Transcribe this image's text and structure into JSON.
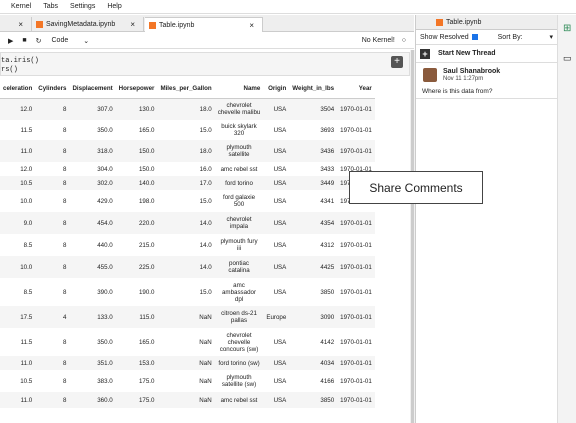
{
  "menu": [
    "Kernel",
    "Tabs",
    "Settings",
    "Help"
  ],
  "tabs": [
    {
      "label": "SavingMetadata.ipynb"
    },
    {
      "label": "Table.ipynb"
    }
  ],
  "toolbar": {
    "cell_type": "Code",
    "kernel_status": "No Kernel!"
  },
  "code": {
    "line1": "ta.iris()",
    "line2": "rs()"
  },
  "table": {
    "headers": [
      "celeration",
      "Cylinders",
      "Displacement",
      "Horsepower",
      "Miles_per_Gallon",
      "Name",
      "Origin",
      "Weight_in_lbs",
      "Year"
    ],
    "rows": [
      [
        "12.0",
        "8",
        "307.0",
        "130.0",
        "18.0",
        "chevrolet\nchevelle malibu",
        "USA",
        "3504",
        "1970-01-01"
      ],
      [
        "11.5",
        "8",
        "350.0",
        "165.0",
        "15.0",
        "buick skylark\n320",
        "USA",
        "3693",
        "1970-01-01"
      ],
      [
        "11.0",
        "8",
        "318.0",
        "150.0",
        "18.0",
        "plymouth\nsatellite",
        "USA",
        "3436",
        "1970-01-01"
      ],
      [
        "12.0",
        "8",
        "304.0",
        "150.0",
        "16.0",
        "amc rebel sst",
        "USA",
        "3433",
        "1970-01-01"
      ],
      [
        "10.5",
        "8",
        "302.0",
        "140.0",
        "17.0",
        "ford torino",
        "USA",
        "3449",
        "1970-01-01"
      ],
      [
        "10.0",
        "8",
        "429.0",
        "198.0",
        "15.0",
        "ford galaxie\n500",
        "USA",
        "4341",
        "1970-01-01"
      ],
      [
        "9.0",
        "8",
        "454.0",
        "220.0",
        "14.0",
        "chevrolet\nimpala",
        "USA",
        "4354",
        "1970-01-01"
      ],
      [
        "8.5",
        "8",
        "440.0",
        "215.0",
        "14.0",
        "plymouth fury\niii",
        "USA",
        "4312",
        "1970-01-01"
      ],
      [
        "10.0",
        "8",
        "455.0",
        "225.0",
        "14.0",
        "pontiac\ncatalina",
        "USA",
        "4425",
        "1970-01-01"
      ],
      [
        "8.5",
        "8",
        "390.0",
        "190.0",
        "15.0",
        "amc\nambassador\ndpl",
        "USA",
        "3850",
        "1970-01-01"
      ],
      [
        "17.5",
        "4",
        "133.0",
        "115.0",
        "NaN",
        "citroen ds-21\npallas",
        "Europe",
        "3090",
        "1970-01-01"
      ],
      [
        "11.5",
        "8",
        "350.0",
        "165.0",
        "NaN",
        "chevrolet\nchevelle\nconcours (sw)",
        "USA",
        "4142",
        "1970-01-01"
      ],
      [
        "11.0",
        "8",
        "351.0",
        "153.0",
        "NaN",
        "ford torino (sw)",
        "USA",
        "4034",
        "1970-01-01"
      ],
      [
        "10.5",
        "8",
        "383.0",
        "175.0",
        "NaN",
        "plymouth\nsatellite (sw)",
        "USA",
        "4166",
        "1970-01-01"
      ],
      [
        "11.0",
        "8",
        "360.0",
        "175.0",
        "NaN",
        "amc rebel sst",
        "USA",
        "3850",
        "1970-01-01"
      ]
    ]
  },
  "side": {
    "title": "Table.ipynb",
    "show_resolved": "Show Resolved",
    "sort_by": "Sort By:",
    "new_thread": "Start New Thread",
    "comment": {
      "author": "Saul Shanabrook",
      "date": "Nov 11 1:27pm",
      "text": "Where is this data from?"
    }
  },
  "overlay": {
    "label": "Share Comments"
  }
}
